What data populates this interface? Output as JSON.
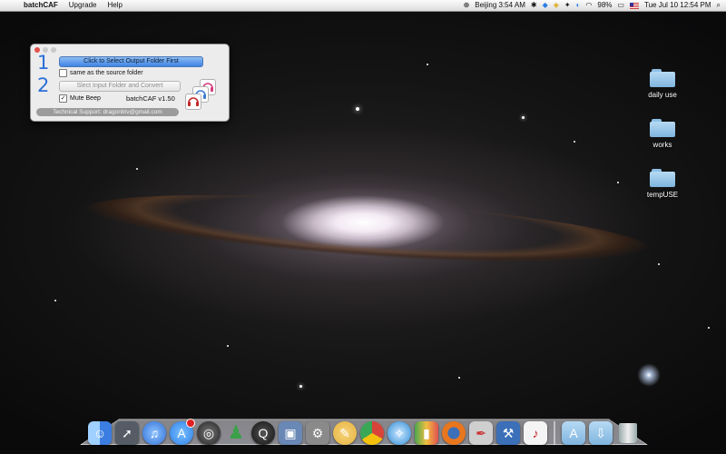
{
  "menubar": {
    "app_name": "batchCAF",
    "items": [
      "Upgrade",
      "Help"
    ],
    "clock_city": "Beijing 3:54 AM",
    "battery": "98%",
    "datetime": "Tue Jul 10  12:54 PM"
  },
  "window": {
    "step1": "1",
    "step2": "2",
    "output_button": "Click to Select Output Folder First",
    "same_folder_label": "same as the source folder",
    "same_folder_checked": false,
    "input_button": "Slect Input Folder and Convert",
    "mute_label": "Mute Beep",
    "mute_checked": true,
    "version": "batchCAF v1.50",
    "support": "Technical Support:  dragonbtv@gmail.com"
  },
  "desktop": {
    "folders": [
      "daily use",
      "works",
      "tempUSE"
    ]
  },
  "dock": {
    "apps": [
      "finder-icon",
      "launchpad-icon",
      "itunes-icon",
      "app-store-icon",
      "dvd-player-icon",
      "messenger-icon",
      "quicktime-icon",
      "preview-icon",
      "system-preferences-icon",
      "sketch-icon",
      "chrome-icon",
      "safari-icon",
      "stocks-icon",
      "firefox-icon",
      "script-editor-icon",
      "xcode-icon",
      "batchcaf-icon"
    ],
    "colors": {
      "finder": "#3b7de0",
      "launchpad": "#555c66",
      "itunes": "#2f6fd6",
      "app_store": "#2a7ee6",
      "dvd": "#333333",
      "messenger": "#3aa04a",
      "quicktime": "#222222",
      "preview": "#6a88b5",
      "sysprefs": "#8a8a8a",
      "sketch": "#e7b33d",
      "chrome": "#d9443a",
      "safari": "#2b8bd6",
      "stocks": "#4aa64e",
      "firefox": "#e8761e",
      "script": "#cfcfcf",
      "xcode": "#3b6fb8",
      "batchcaf": "#f4f4f4"
    }
  }
}
